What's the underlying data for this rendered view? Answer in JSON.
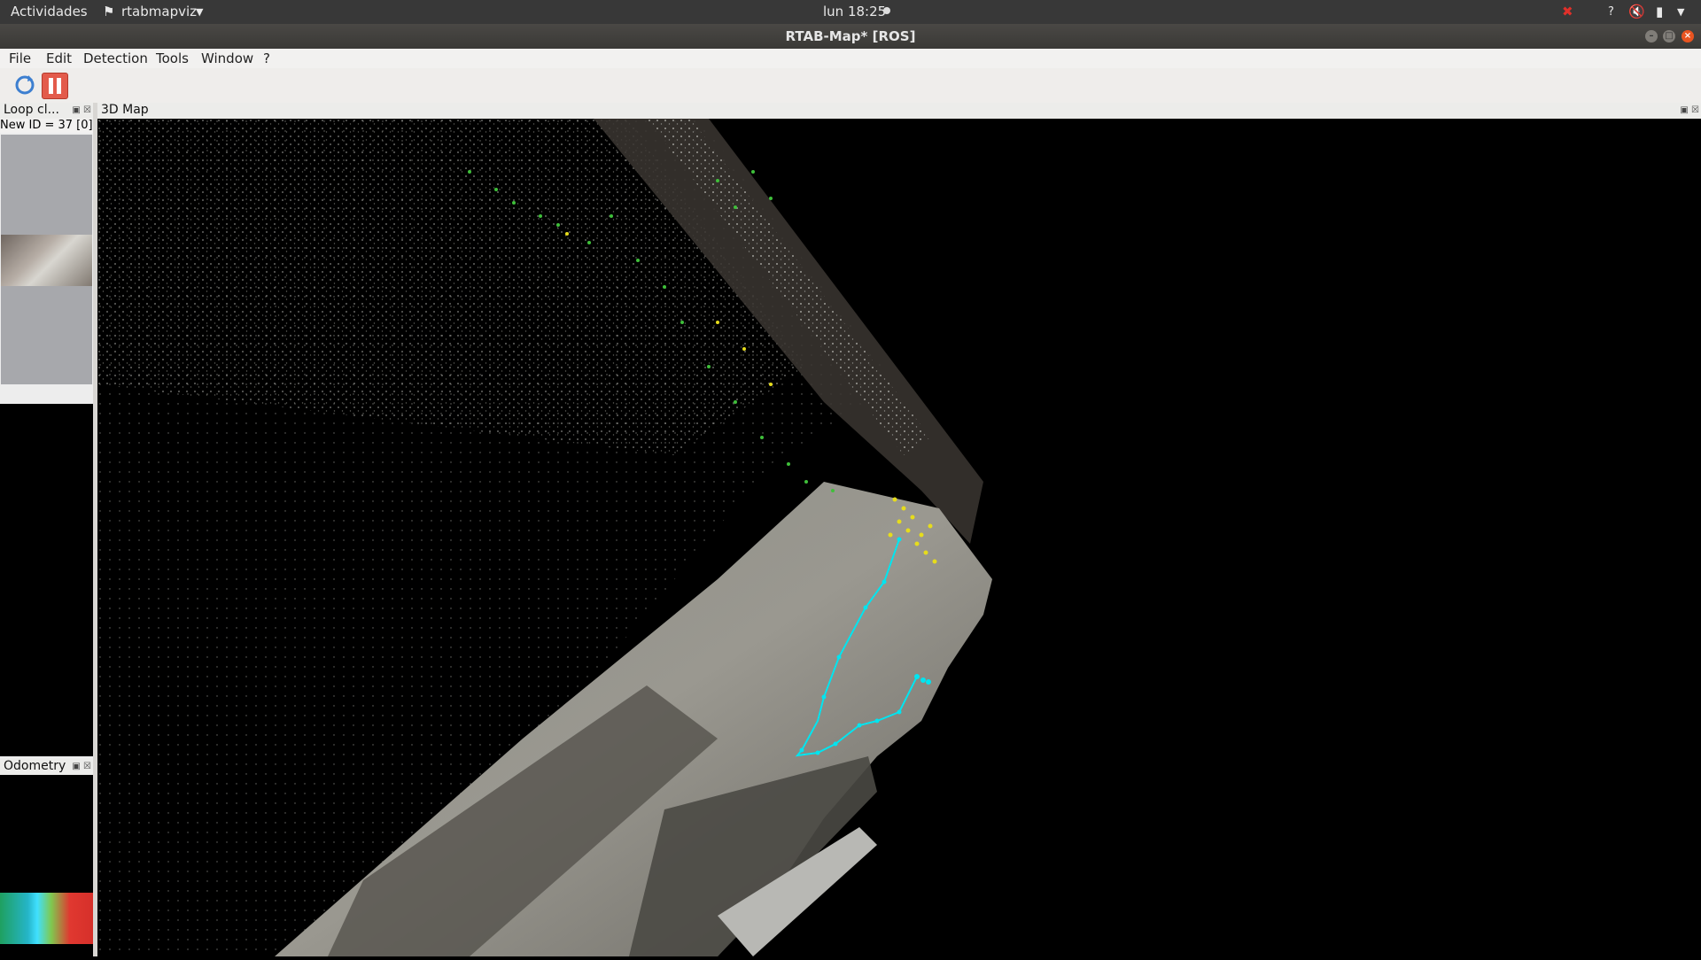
{
  "system_bar": {
    "activities": "Actividades",
    "app_menu": "rtabmapviz",
    "clock": "lun 18:25"
  },
  "window": {
    "title": "RTAB-Map* [ROS]"
  },
  "menu": [
    "File",
    "Edit",
    "Detection",
    "Tools",
    "Window",
    "?"
  ],
  "toolbar": {
    "refresh_icon": "refresh-icon",
    "pause_icon": "pause-icon"
  },
  "loop_closure_panel": {
    "title": "Loop cl...",
    "new_id": "New ID = 37 [0]"
  },
  "odometry_panel": {
    "title": "Odometry"
  },
  "map_panel": {
    "title": "3D Map"
  },
  "trajectory_color": "#00e5f0"
}
